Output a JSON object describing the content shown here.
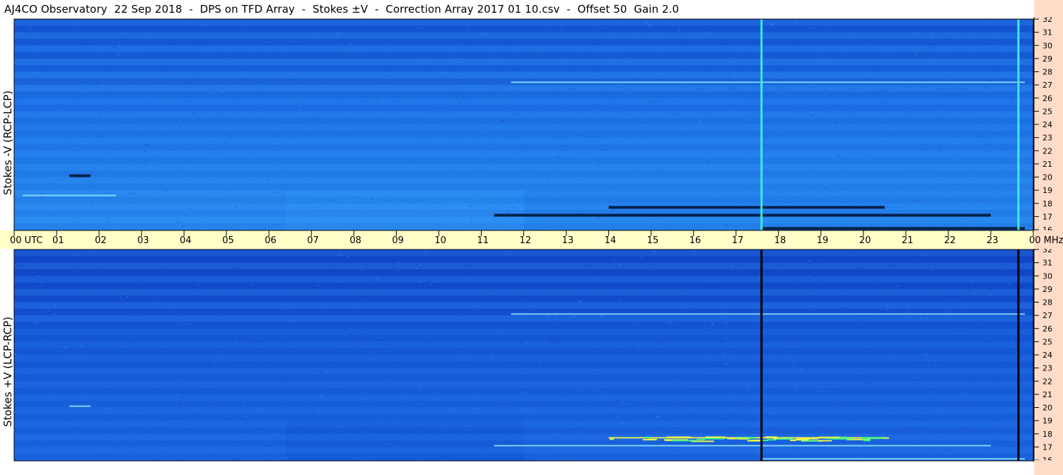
{
  "title": "AJ4CO Observatory  22 Sep 2018  -  DPS on TFD Array  -  Stokes ±V  -  Correction Array 2017 01 10.csv  -  Offset 50  Gain 2.0",
  "colors": {
    "plot_background": "#1a6fe0",
    "time_axis_band": "#ffffc8",
    "freq_axis_band": "#ffdcc8",
    "strong_emission": "#ffff40",
    "weak_emission": "#001030"
  },
  "chart_data": [
    {
      "type": "heatmap",
      "panel": "top",
      "ylabel": "Stokes -V (RCP-LCP)",
      "y_unit": "MHz",
      "ylim": [
        16,
        32
      ],
      "y_ticks": [
        "16",
        "17",
        "18",
        "19",
        "20",
        "21",
        "22",
        "23",
        "24",
        "25",
        "26",
        "27",
        "28",
        "29",
        "30",
        "31",
        "32"
      ],
      "xlim": [
        0,
        24
      ],
      "vertical_lines": [
        {
          "x": 17.6,
          "color": "#40e8e0"
        },
        {
          "x": 23.65,
          "color": "#40e8e0"
        }
      ],
      "horizontal_features": [
        {
          "freq": 17.7,
          "x_start": 14.0,
          "x_end": 20.5,
          "kind": "dark"
        },
        {
          "freq": 17.1,
          "x_start": 11.3,
          "x_end": 23.0,
          "kind": "dark"
        },
        {
          "freq": 16.1,
          "x_start": 17.6,
          "x_end": 23.8,
          "kind": "dark"
        },
        {
          "freq": 18.6,
          "x_start": 0.2,
          "x_end": 2.4,
          "kind": "bright"
        },
        {
          "freq": 27.2,
          "x_start": 11.7,
          "x_end": 23.8,
          "kind": "bright"
        },
        {
          "freq": 20.1,
          "x_start": 1.3,
          "x_end": 1.8,
          "kind": "dark"
        }
      ]
    },
    {
      "type": "heatmap",
      "panel": "bottom",
      "ylabel": "Stokes +V (LCP-RCP)",
      "y_unit": "MHz",
      "ylim": [
        16,
        32
      ],
      "y_ticks": [
        "16",
        "17",
        "18",
        "19",
        "20",
        "21",
        "22",
        "23",
        "24",
        "25",
        "26",
        "27",
        "28",
        "29",
        "30",
        "31",
        "32"
      ],
      "xlim": [
        0,
        24
      ],
      "vertical_lines": [
        {
          "x": 17.6,
          "color": "#000000"
        },
        {
          "x": 23.65,
          "color": "#000000"
        }
      ],
      "horizontal_features": [
        {
          "freq": 17.7,
          "x_start": 14.0,
          "x_end": 20.5,
          "kind": "strong"
        },
        {
          "freq": 17.1,
          "x_start": 11.3,
          "x_end": 23.0,
          "kind": "bright"
        },
        {
          "freq": 16.1,
          "x_start": 17.6,
          "x_end": 23.8,
          "kind": "bright"
        },
        {
          "freq": 27.1,
          "x_start": 11.7,
          "x_end": 23.8,
          "kind": "bright"
        },
        {
          "freq": 20.1,
          "x_start": 1.3,
          "x_end": 1.8,
          "kind": "bright"
        }
      ]
    }
  ],
  "time_axis": {
    "labels": [
      "00",
      "01",
      "02",
      "03",
      "04",
      "05",
      "06",
      "07",
      "08",
      "09",
      "10",
      "11",
      "12",
      "13",
      "14",
      "15",
      "16",
      "17",
      "18",
      "19",
      "20",
      "21",
      "22",
      "23",
      "00"
    ],
    "first_label_suffix": "UTC",
    "last_label_suffix": "MHz"
  }
}
